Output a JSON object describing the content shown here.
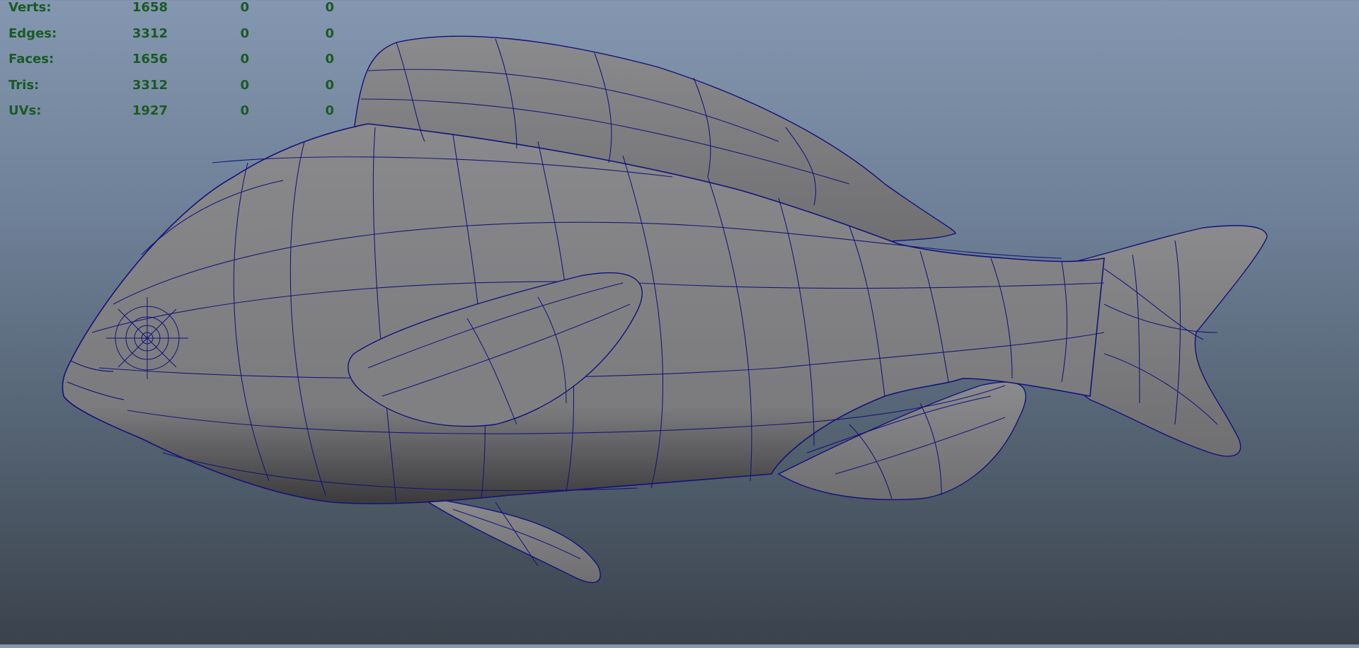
{
  "hud": {
    "rows": [
      {
        "label": "Verts:",
        "v1": "1658",
        "v2": "0",
        "v3": "0"
      },
      {
        "label": "Edges:",
        "v1": "3312",
        "v2": "0",
        "v3": "0"
      },
      {
        "label": "Faces:",
        "v1": "1656",
        "v2": "0",
        "v3": "0"
      },
      {
        "label": "Tris:",
        "v1": "3312",
        "v2": "0",
        "v3": "0"
      },
      {
        "label": "UVs:",
        "v1": "1927",
        "v2": "0",
        "v3": "0"
      }
    ]
  },
  "colors": {
    "wire": "#12127a",
    "mesh_fill": "#7d7d80",
    "hud_text": "#1a5a23"
  }
}
